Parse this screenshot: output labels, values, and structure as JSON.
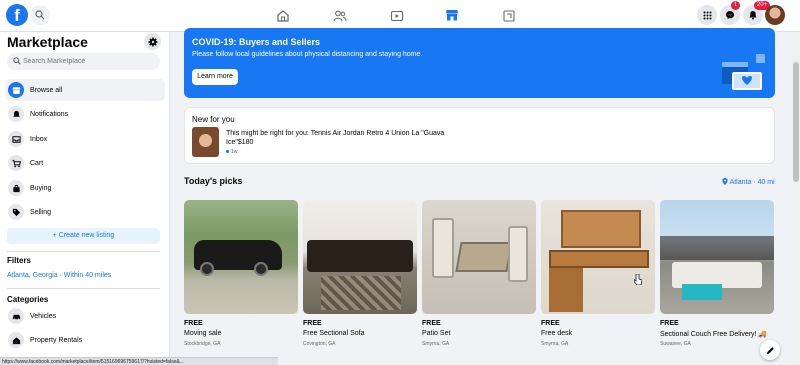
{
  "colors": {
    "brand": "#1877f2",
    "background": "#f0f2f5",
    "notification": "#e41e3f"
  },
  "topbar": {
    "logo": "f",
    "nav_tabs": [
      "home-icon",
      "friends-icon",
      "watch-icon",
      "marketplace-icon",
      "gaming-icon"
    ],
    "active_tab": "marketplace-icon",
    "messenger_badge": "1",
    "notifications_badge": "20+"
  },
  "sidebar": {
    "title": "Marketplace",
    "search_placeholder": "Search Marketplace",
    "items": [
      {
        "label": "Browse all",
        "icon": "storefront-icon"
      },
      {
        "label": "Notifications",
        "icon": "bell-icon"
      },
      {
        "label": "Inbox",
        "icon": "inbox-icon"
      },
      {
        "label": "Cart",
        "icon": "cart-icon"
      },
      {
        "label": "Buying",
        "icon": "bag-icon"
      },
      {
        "label": "Selling",
        "icon": "tag-icon"
      }
    ],
    "create_listing": "+ Create new listing",
    "filters_heading": "Filters",
    "filter_location": "Atlanta, Georgia · Within 40 miles",
    "categories_heading": "Categories",
    "categories": [
      {
        "label": "Vehicles",
        "icon": "car-icon"
      },
      {
        "label": "Property Rentals",
        "icon": "house-icon"
      }
    ]
  },
  "covid_banner": {
    "title": "COVID-19: Buyers and Sellers",
    "text": "Please follow local guidelines about physical distancing and staying home.",
    "button": "Learn more"
  },
  "new_for_you": {
    "title": "New for you",
    "text_prefix": "This might be right for you: ",
    "item": "Tennis Air Jordan Retro 4 Union La \"Guava Ice\"",
    "price": "$180",
    "time": "1w"
  },
  "todays_picks": {
    "title": "Today's picks",
    "location": "Atlanta · 40 mi",
    "cards": [
      {
        "price": "FREE",
        "title": "Moving sale",
        "location": "Stockbridge, GA"
      },
      {
        "price": "FREE",
        "title": "Free Sectional Sofa",
        "location": "Covington, GA"
      },
      {
        "price": "FREE",
        "title": "Patio Set",
        "location": "Smyrna, GA"
      },
      {
        "price": "FREE",
        "title": "Free desk",
        "location": "Smyrna, GA"
      },
      {
        "price": "FREE",
        "title": "Sectional Couch Free Delivery! 🚚",
        "location": "Suwanee, GA"
      }
    ]
  },
  "status_url": "https://www.facebook.com/marketplace/item/515169696759617/?hoisted=false&..."
}
